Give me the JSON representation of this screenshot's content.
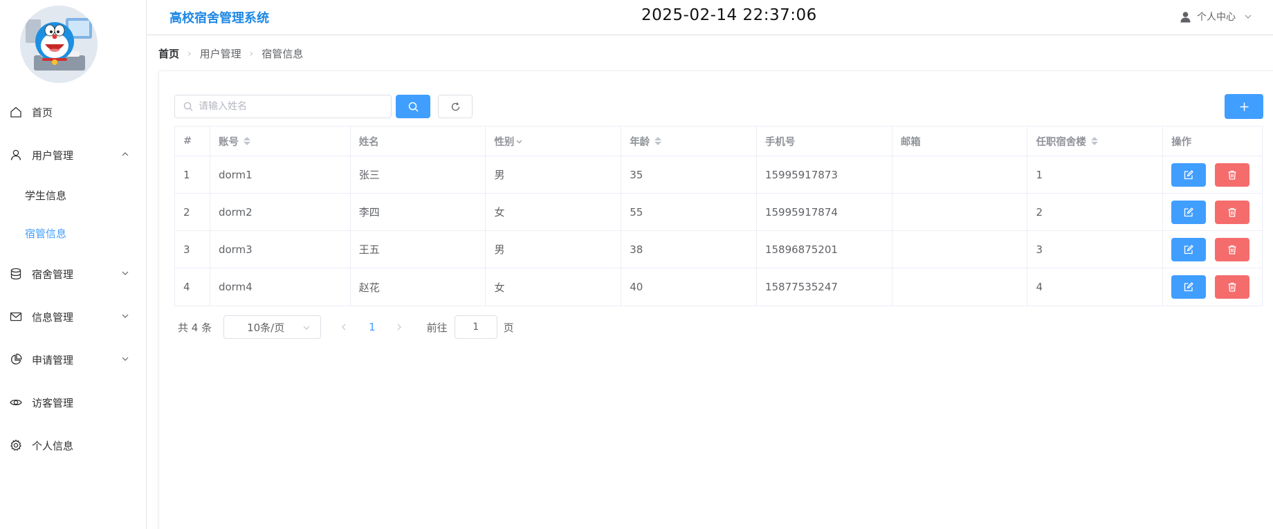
{
  "header": {
    "title": "高校宿舍管理系统",
    "clock": "2025-02-14 22:37:06",
    "user_center": "个人中心"
  },
  "sidebar": {
    "items": [
      {
        "label": "首页",
        "icon": "home-icon"
      },
      {
        "label": "用户管理",
        "icon": "user-icon",
        "expanded": true,
        "children": [
          {
            "label": "学生信息"
          },
          {
            "label": "宿管信息",
            "active": true
          }
        ]
      },
      {
        "label": "宿舍管理",
        "icon": "database-icon"
      },
      {
        "label": "信息管理",
        "icon": "mail-icon"
      },
      {
        "label": "申请管理",
        "icon": "pie-chart-icon"
      },
      {
        "label": "访客管理",
        "icon": "eye-icon"
      },
      {
        "label": "个人信息",
        "icon": "gear-icon"
      }
    ]
  },
  "breadcrumb": [
    "首页",
    "用户管理",
    "宿管信息"
  ],
  "search": {
    "placeholder": "请输入姓名",
    "value": ""
  },
  "table": {
    "columns": [
      "#",
      "账号",
      "姓名",
      "性别",
      "年龄",
      "手机号",
      "邮箱",
      "任职宿舍楼",
      "操作"
    ],
    "rows": [
      {
        "index": "1",
        "account": "dorm1",
        "name": "张三",
        "gender": "男",
        "age": "35",
        "phone": "15995917873",
        "email": "",
        "building": "1"
      },
      {
        "index": "2",
        "account": "dorm2",
        "name": "李四",
        "gender": "女",
        "age": "55",
        "phone": "15995917874",
        "email": "",
        "building": "2"
      },
      {
        "index": "3",
        "account": "dorm3",
        "name": "王五",
        "gender": "男",
        "age": "38",
        "phone": "15896875201",
        "email": "",
        "building": "3"
      },
      {
        "index": "4",
        "account": "dorm4",
        "name": "赵花",
        "gender": "女",
        "age": "40",
        "phone": "15877535247",
        "email": "",
        "building": "4"
      }
    ]
  },
  "pagination": {
    "total": "共 4 条",
    "page_size": "10条/页",
    "current_page": "1",
    "goto_label": "前往",
    "goto_value": "1",
    "goto_suffix": "页"
  },
  "colors": {
    "primary": "#409eff",
    "danger": "#f56c6c",
    "title_blue": "#1e88e5"
  }
}
